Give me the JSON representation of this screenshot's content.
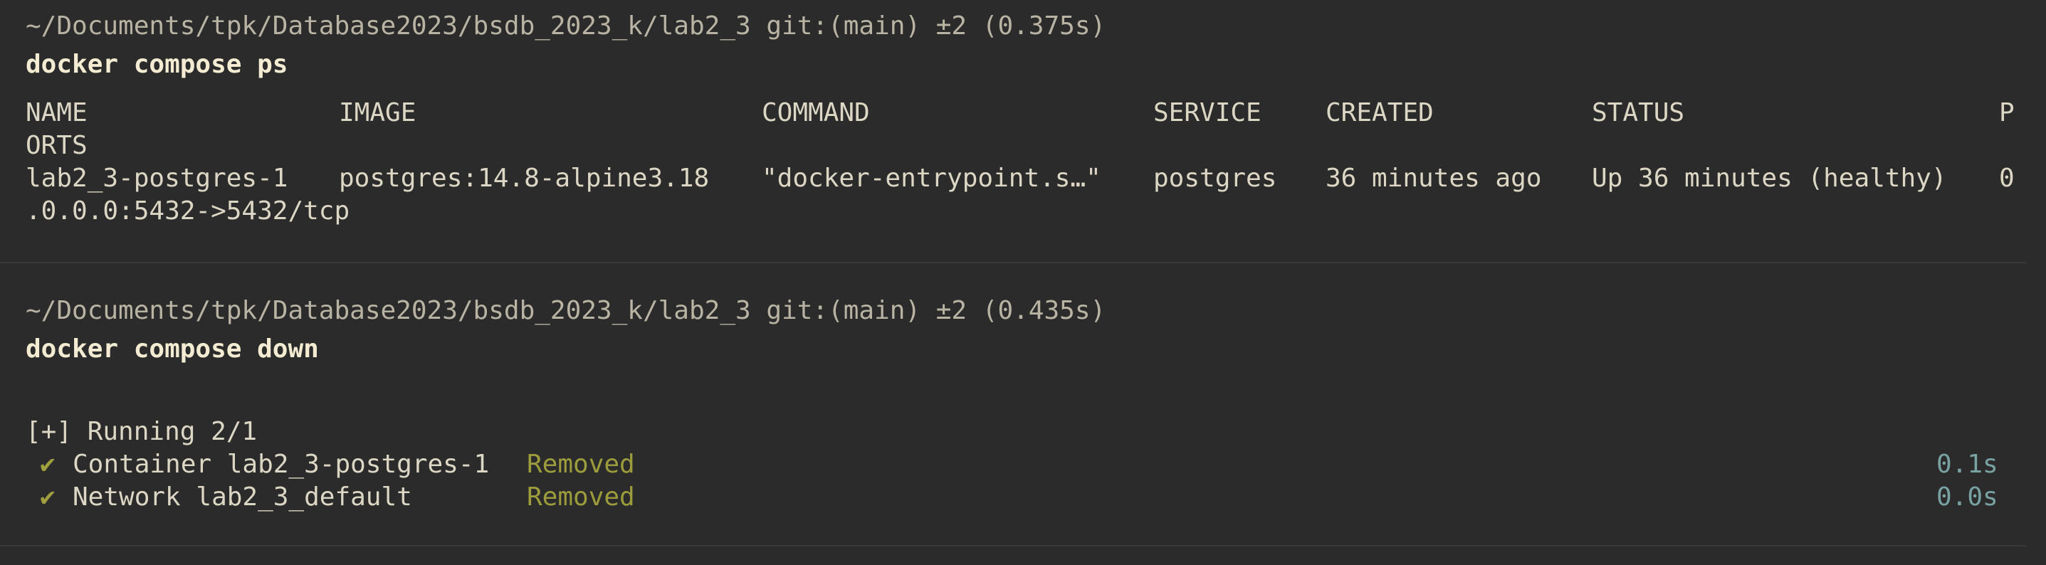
{
  "block1": {
    "prompt": "~/Documents/tpk/Database2023/bsdb_2023_k/lab2_3 git:(main) ±2 (0.375s)",
    "command": "docker compose ps",
    "headers": {
      "name": "NAME",
      "image": "IMAGE",
      "command": "COMMAND",
      "service": "SERVICE",
      "created": "CREATED",
      "status": "STATUS",
      "ports_p": "P",
      "ports_rest": "ORTS"
    },
    "row": {
      "name": "lab2_3-postgres-1",
      "image": "postgres:14.8-alpine3.18",
      "command": "\"docker-entrypoint.s…\"",
      "service": "postgres",
      "created": "36 minutes ago",
      "status": "Up 36 minutes (healthy)",
      "ports_0": "0",
      "ports_rest": ".0.0.0:5432->5432/tcp"
    }
  },
  "block2": {
    "prompt": "~/Documents/tpk/Database2023/bsdb_2023_k/lab2_3 git:(main) ±2 (0.435s)",
    "command": "docker compose down",
    "running": "[+] Running 2/1",
    "items": [
      {
        "check": "✔",
        "label": "Container lab2_3-postgres-1",
        "state": "Removed",
        "time": "0.1s"
      },
      {
        "check": "✔",
        "label": "Network lab2_3_default",
        "state": "Removed",
        "time": "0.0s"
      }
    ]
  },
  "colors": {
    "background": "#2b2b2b",
    "text": "#dcd6c4",
    "removed": "#9c9c3c",
    "timing": "#79a3a3"
  }
}
